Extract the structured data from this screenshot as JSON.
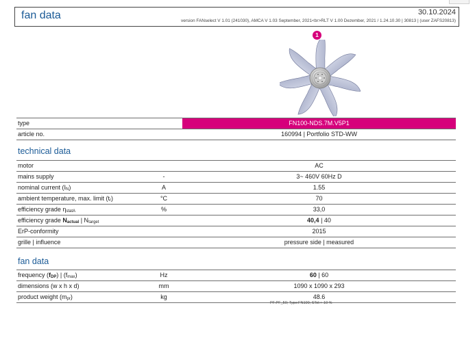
{
  "header": {
    "title": "fan data",
    "date": "30.10.2024",
    "version": "version  FANselect V 1.01 (241030), AMCA V 1.03 September, 2021<br>RLT V 1.00 Dezember, 2021 / 1.24.10.30 | 30813 | (user ZAFS20813)"
  },
  "image": {
    "badge": "1",
    "icon": "axial-fan-impeller-icon"
  },
  "colors": {
    "accent": "#d6007b",
    "heading": "#1a5a96"
  },
  "identity": {
    "type_label": "type",
    "type_value": "FN100-NDS.7M.V5P1",
    "article_label": "article no.",
    "article_value": "160994  | Portfolio STD-WW"
  },
  "technical": {
    "title": "technical data",
    "motor": {
      "label": "motor",
      "value": "AC"
    },
    "mains": {
      "label": "mains supply",
      "unit": "-",
      "value": "3~ 460V 60Hz D"
    },
    "current": {
      "label": "nominal current (I",
      "sub": "N",
      "close": ")",
      "unit": "A",
      "value": "1.55"
    },
    "ambient": {
      "label": "ambient temperature, max. limit (t",
      "sub": "r",
      "close": ")",
      "unit": "°C",
      "value": "70"
    },
    "eff_grade": {
      "label": "efficiency grade η",
      "sub": "statA",
      "unit": "%",
      "value": "33,0"
    },
    "eff_n": {
      "label_a": "efficiency grade ",
      "label_b": "N",
      "sub_b": "actual",
      "label_c": " | N",
      "sub_c": "target",
      "value_bold": "40,4",
      "value_rest": " | 40"
    },
    "erp": {
      "label": "ErP-conformity",
      "value": "2015"
    },
    "grille": {
      "label": "grille | influence",
      "value": "pressure side | measured"
    }
  },
  "fan": {
    "title": "fan data",
    "frequency": {
      "label_a": "frequency (",
      "label_b": "f",
      "sub_b": "DP",
      "label_c": ") | (f",
      "sub_c": "max",
      "label_d": ")",
      "unit": "Hz",
      "value_bold": "60",
      "value_rest": " | 60"
    },
    "dimensions": {
      "label": "dimensions (w x h x d)",
      "unit": "mm",
      "value": "1090 x 1090 x 293"
    },
    "weight": {
      "label": "product weight (m",
      "sub": "pr",
      "close": ")",
      "unit": "kg",
      "value": "48.6"
    }
  },
  "footnote": "PF:PF_50; Type:FN100; STol:+-10 %"
}
